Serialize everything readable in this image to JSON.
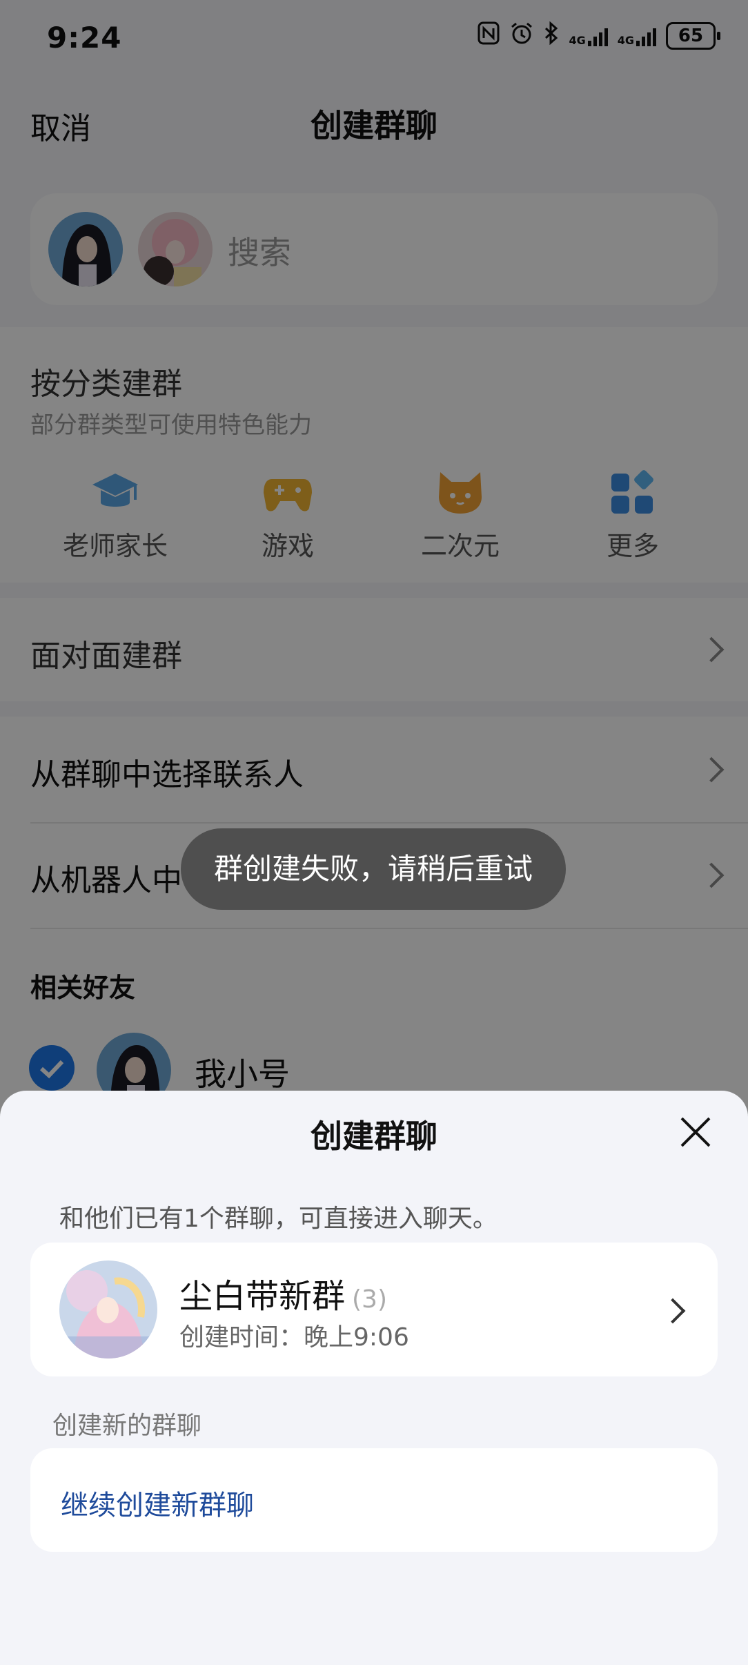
{
  "status_bar": {
    "time": "9:24",
    "network1": "4G",
    "network2": "4G",
    "battery": "65"
  },
  "header": {
    "cancel_label": "取消",
    "title": "创建群聊"
  },
  "search": {
    "placeholder": "搜索",
    "selected_avatars": [
      "avatar-1",
      "avatar-2"
    ]
  },
  "category": {
    "title": "按分类建群",
    "subtitle": "部分群类型可使用特色能力",
    "items": [
      {
        "label": "老师家长",
        "icon": "graduation-cap-icon",
        "color": "#5aa7e6"
      },
      {
        "label": "游戏",
        "icon": "gamepad-icon",
        "color": "#f2b533"
      },
      {
        "label": "二次元",
        "icon": "cat-face-icon",
        "color": "#f2a235"
      },
      {
        "label": "更多",
        "icon": "grid-icon",
        "color": "#3d8de0"
      }
    ]
  },
  "rows": {
    "face_to_face": "面对面建群",
    "from_group": "从群聊中选择联系人",
    "from_robot": "从机器人中"
  },
  "friends": {
    "title": "相关好友",
    "items": [
      {
        "name": "我小号",
        "checked": true
      }
    ]
  },
  "toast": {
    "message": "群创建失败，请稍后重试"
  },
  "sheet": {
    "title": "创建群聊",
    "existing_hint": "和他们已有1个群聊，可直接进入聊天。",
    "group": {
      "name": "尘白带新群",
      "count": "(3)",
      "created": "创建时间：晚上9:06"
    },
    "new_group_label": "创建新的群聊",
    "new_group_action": "继续创建新群聊"
  },
  "colors": {
    "accent": "#1e78e8",
    "link": "#1f4b9b",
    "overlay": "rgba(0,0,0,0.48)"
  }
}
